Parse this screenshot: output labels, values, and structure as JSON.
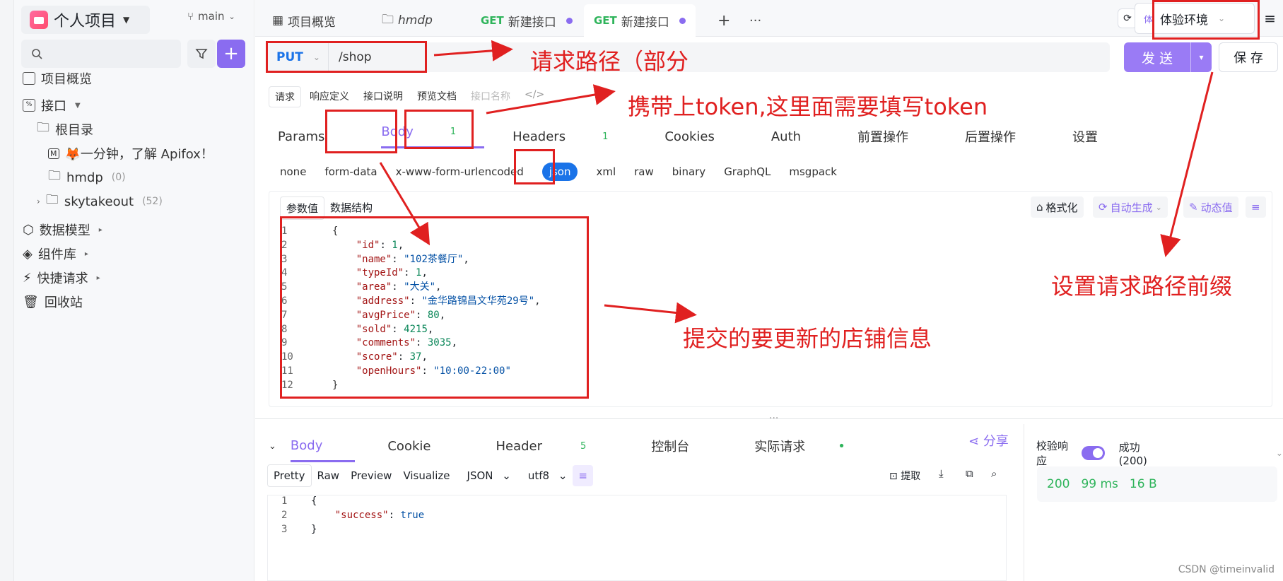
{
  "sidebar": {
    "project_title": "个人项目",
    "branch": "main",
    "search_placeholder": "",
    "items": [
      {
        "label": "项目概览"
      },
      {
        "label": "接口"
      },
      {
        "label": "根目录"
      },
      {
        "label": "🦊一分钟，了解 Apifox！",
        "icon_label": "M"
      },
      {
        "label": "hmdp",
        "count": "(0)"
      },
      {
        "label": "skytakeout",
        "count": "(52)"
      },
      {
        "label": "数据模型"
      },
      {
        "label": "组件库"
      },
      {
        "label": "快捷请求"
      },
      {
        "label": "回收站"
      }
    ]
  },
  "tabs": [
    {
      "label": "项目概览"
    },
    {
      "label": "hmdp"
    },
    {
      "method": "GET",
      "label": "新建接口"
    },
    {
      "method": "GET",
      "label": "新建接口"
    }
  ],
  "env": {
    "badge": "体",
    "label": "体验环境"
  },
  "request": {
    "method": "PUT",
    "path": "/shop",
    "send_label": "发 送",
    "save_label": "保 存",
    "sub_tabs": [
      "请求",
      "响应定义",
      "接口说明",
      "预览文档"
    ],
    "name_placeholder": "接口名称",
    "param_tabs": [
      {
        "label": "Params"
      },
      {
        "label": "Body",
        "count": "1"
      },
      {
        "label": "Headers",
        "count": "1"
      },
      {
        "label": "Cookies"
      },
      {
        "label": "Auth"
      },
      {
        "label": "前置操作"
      },
      {
        "label": "后置操作"
      },
      {
        "label": "设置"
      }
    ],
    "body_types": [
      "none",
      "form-data",
      "x-www-form-urlencoded",
      "json",
      "xml",
      "raw",
      "binary",
      "GraphQL",
      "msgpack"
    ],
    "editor_tabs": [
      "参数值",
      "数据结构"
    ],
    "tools": [
      "格式化",
      "自动生成",
      "动态值"
    ],
    "line_numbers": [
      "1",
      "2",
      "3",
      "4",
      "5",
      "6",
      "7",
      "8",
      "9",
      "10",
      "11",
      "12"
    ]
  },
  "response": {
    "tabs": [
      {
        "label": "Body"
      },
      {
        "label": "Cookie"
      },
      {
        "label": "Header",
        "count": "5"
      },
      {
        "label": "控制台"
      },
      {
        "label": "实际请求"
      }
    ],
    "share_label": "分享",
    "formats": [
      "Pretty",
      "Raw",
      "Preview",
      "Visualize",
      "JSON",
      "utf8"
    ],
    "extract_label": "提取",
    "line_numbers": [
      "1",
      "2",
      "3"
    ],
    "validate_label": "校验响应",
    "result_label": "成功 (200)",
    "status_code": "200",
    "time": "99 ms",
    "size": "16 B"
  },
  "annotations": {
    "path": "请求路径（部分",
    "token": "携带上token,这里面需要填写token",
    "prefix": "设置请求路径前缀",
    "body": "提交的要更新的店铺信息"
  },
  "watermark": "CSDN @timeinvalid",
  "colors": {
    "accent": "#8a6cf0",
    "get": "#2fb45b",
    "put": "#1a73e8",
    "annotation": "#e02020"
  }
}
